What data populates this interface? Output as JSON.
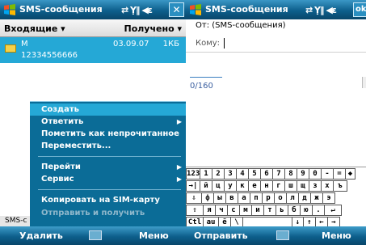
{
  "left": {
    "title": "SMS-сообщения",
    "indicators": "⇄ Ỵ‖ ◀ε",
    "close_label": "✕",
    "list_header": {
      "folder": "Входящие ▾",
      "sort": "Получено ▾"
    },
    "message": {
      "sender": "M",
      "date": "03.09.07",
      "size": "1КБ",
      "phone": "12334556666"
    },
    "status_label": "SMS-с",
    "menu": [
      {
        "label": "Создать",
        "selected": true,
        "submenu": false,
        "disabled": false
      },
      {
        "label": "Ответить",
        "selected": false,
        "submenu": true,
        "disabled": false
      },
      {
        "label": "Пометить как непрочитанное",
        "selected": false,
        "submenu": false,
        "disabled": false
      },
      {
        "label": "Переместить...",
        "selected": false,
        "submenu": false,
        "disabled": false
      },
      {
        "label": "Перейти",
        "selected": false,
        "submenu": true,
        "disabled": false
      },
      {
        "label": "Сервис",
        "selected": false,
        "submenu": true,
        "disabled": false
      },
      {
        "label": "Копировать на SIM-карту",
        "selected": false,
        "submenu": false,
        "disabled": false
      },
      {
        "label": "Отправить и получить",
        "selected": false,
        "submenu": false,
        "disabled": true
      }
    ],
    "softkeys": {
      "left": "Удалить",
      "right": "Меню"
    }
  },
  "right": {
    "title": "SMS-сообщения",
    "indicators": "⇄ Ỵ‖ ◀ε",
    "ok_label": "ok",
    "from": "От: (SMS-сообщения)",
    "to_label": "Кому:",
    "char_count": "0/160",
    "softkeys": {
      "left": "Отправить",
      "right": "Меню"
    },
    "keyboard": {
      "row1": [
        "123",
        "1",
        "2",
        "3",
        "4",
        "5",
        "6",
        "7",
        "8",
        "9",
        "0",
        "-",
        "=",
        "◆"
      ],
      "row2": [
        "→|",
        "й",
        "ц",
        "у",
        "к",
        "е",
        "н",
        "г",
        "ш",
        "щ",
        "з",
        "х",
        "ъ"
      ],
      "row3": [
        "⇩",
        "ф",
        "ы",
        "в",
        "а",
        "п",
        "р",
        "о",
        "л",
        "д",
        "ж",
        "э"
      ],
      "row4": [
        "⇧",
        "я",
        "ч",
        "с",
        "м",
        "и",
        "т",
        "ь",
        "б",
        "ю",
        ".",
        "↵"
      ],
      "row5": [
        "Ctl",
        "au",
        "ё",
        "\\",
        "",
        "↓",
        "↑",
        "←",
        "→"
      ]
    }
  },
  "colors": {
    "titlebar": "#0d5f8c",
    "selection": "#25a8d6",
    "menu_bg": "#0b6c97"
  }
}
